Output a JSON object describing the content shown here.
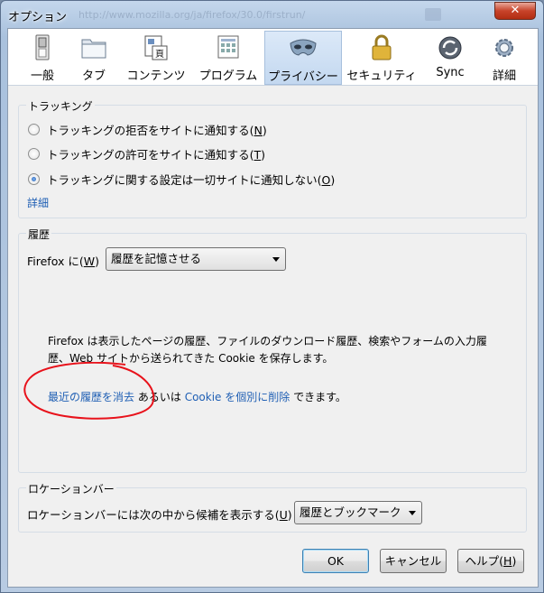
{
  "window": {
    "title": "オプション",
    "close_label": "✕",
    "background_url": "http://www.mozilla.org/ja/firefox/30.0/firstrun/"
  },
  "tabs": [
    {
      "label": "一般",
      "icon": "general-switch-icon",
      "selected": false
    },
    {
      "label": "タブ",
      "icon": "tabs-folder-icon",
      "selected": false
    },
    {
      "label": "コンテンツ",
      "icon": "content-page-icon",
      "selected": false
    },
    {
      "label": "プログラム",
      "icon": "applications-icon",
      "selected": false
    },
    {
      "label": "プライバシー",
      "icon": "privacy-mask-icon",
      "selected": true
    },
    {
      "label": "セキュリティ",
      "icon": "security-padlock-icon",
      "selected": false
    },
    {
      "label": "Sync",
      "icon": "sync-arrows-icon",
      "selected": false
    },
    {
      "label": "詳細",
      "icon": "advanced-gear-icon",
      "selected": false
    }
  ],
  "tracking": {
    "title": "トラッキング",
    "options": [
      {
        "text": "トラッキングの拒否をサイトに通知する(",
        "key": "N",
        "checked": false
      },
      {
        "text": "トラッキングの許可をサイトに通知する(",
        "key": "T",
        "checked": false
      },
      {
        "text": "トラッキングに関する設定は一切サイトに通知しない(",
        "key": "O",
        "checked": true
      }
    ],
    "details_link": "詳細"
  },
  "history": {
    "title": "履歴",
    "firefox_label": "Firefox に(",
    "firefox_key": "W",
    "mode_value": "履歴を記憶させる",
    "description_line1": "Firefox は表示したページの履歴、ファイルのダウンロード履歴、検索やフォームの入力履",
    "description_line2": "歴、Web サイトから送られてきた Cookie を保存します。",
    "clear_recent_link": "最近の履歴を消去",
    "or_text": "あるいは",
    "remove_cookies_link": "Cookie を個別に削除",
    "can_text": "できます。",
    "annotation_color": "#e8121b"
  },
  "location_bar": {
    "title": "ロケーションバー",
    "label": "ロケーションバーには次の中から候補を表示する(",
    "key": "U",
    "suggest_value": "履歴とブックマーク"
  },
  "buttons": {
    "ok": "OK",
    "cancel": "キャンセル",
    "help": "ヘルプ(",
    "help_key": "H"
  },
  "colors": {
    "link": "#1f5fb4",
    "selected_tab": "#c3d8f0"
  }
}
